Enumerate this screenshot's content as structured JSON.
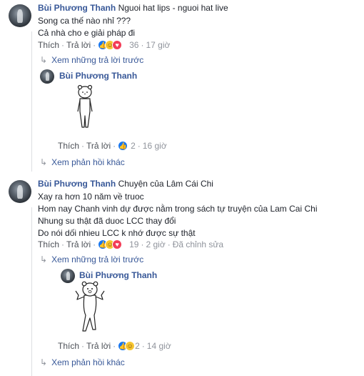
{
  "comments": [
    {
      "author": "Bùi Phương Thanh",
      "text_lines": [
        "Nguoi hat lips - nguoi hat live",
        "Song ca thế nào nhỉ ???",
        "Cả nhà cho e giải pháp đi"
      ],
      "actions": {
        "like": "Thích",
        "reply": "Trả lời",
        "reactions": "36",
        "time": "17 giờ"
      },
      "reaction_icons": [
        "like",
        "haha",
        "love"
      ],
      "previous_replies": "Xem những trả lời trước",
      "reply": {
        "author": "Bùi Phương Thanh",
        "sticker": "bear-standing-sticker",
        "actions": {
          "like": "Thích",
          "reply": "Trả lời",
          "reactions": "2",
          "time": "16 giờ"
        },
        "reaction_icons": [
          "like"
        ]
      },
      "more_replies": "Xem phản hồi khác"
    },
    {
      "author": "Bùi Phương Thanh",
      "text_lines": [
        "Chuyện của Lâm Cái Chi",
        "Xay ra hơn 10 năm về truoc",
        "Hom nay Chanh vinh dự được nằm trong sách tự truyện của Lam Cai Chi",
        "Nhung su thật đã duoc LCC thay đổi",
        "Do nói dối nhieu LCC k nhớ được sự thật"
      ],
      "actions": {
        "like": "Thích",
        "reply": "Trả lời",
        "reactions": "19",
        "time": "2 giờ",
        "edited": "Đã chỉnh sửa"
      },
      "reaction_icons": [
        "like",
        "haha",
        "love"
      ],
      "previous_replies": "Xem những trả lời trước",
      "reply": {
        "author": "Bùi Phương Thanh",
        "sticker": "bear-dancing-sticker",
        "actions": {
          "like": "Thích",
          "reply": "Trả lời",
          "reactions": "2",
          "time": "14 giờ"
        },
        "reaction_icons": [
          "like",
          "haha"
        ]
      },
      "more_replies": "Xem phản hồi khác"
    }
  ]
}
